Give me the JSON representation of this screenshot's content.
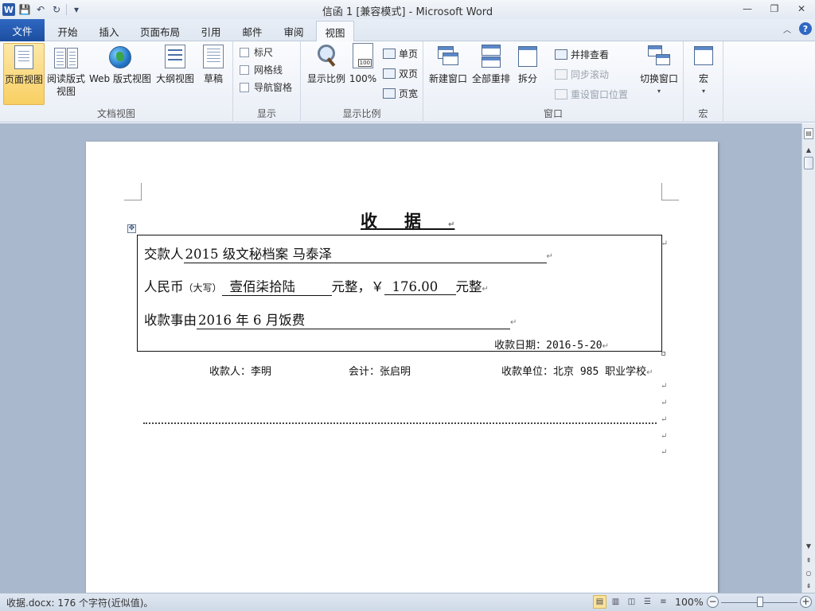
{
  "window": {
    "title": "信函 1 [兼容模式] - Microsoft Word",
    "logo": "W",
    "min_icon": "—",
    "restore_icon": "❐",
    "close_icon": "✕"
  },
  "quick_access": {
    "save": "💾",
    "undo": "↶",
    "redo": "↻",
    "more": "▾"
  },
  "tabs": [
    {
      "label": "文件"
    },
    {
      "label": "开始"
    },
    {
      "label": "插入"
    },
    {
      "label": "页面布局"
    },
    {
      "label": "引用"
    },
    {
      "label": "邮件"
    },
    {
      "label": "审阅"
    },
    {
      "label": "视图"
    }
  ],
  "ribbon": {
    "doc_views": {
      "label": "文档视图",
      "buttons": [
        "页面视图",
        "阅读版式视图",
        "Web 版式视图",
        "大纲视图",
        "草稿"
      ]
    },
    "show": {
      "label": "显示",
      "items": [
        "标尺",
        "网格线",
        "导航窗格"
      ]
    },
    "zoom": {
      "label": "显示比例",
      "zoom_btn": "显示比例",
      "hundred": "100%",
      "one_page": "单页",
      "two_pages": "双页",
      "page_width": "页宽"
    },
    "window": {
      "label": "窗口",
      "new_window": "新建窗口",
      "arrange_all": "全部重排",
      "split": "拆分",
      "side_by_side": "并排查看",
      "sync_scroll": "同步滚动",
      "reset_pos": "重设窗口位置",
      "switch": "切换窗口"
    },
    "macros": {
      "label": "宏",
      "button": "宏"
    }
  },
  "document": {
    "title": "收据",
    "line1_label": "交款人",
    "line1_value": "2015 级文秘档案   马泰泽",
    "line2_label": "人民币",
    "line2_note": "（大写）",
    "line2_value": "壹佰柒拾陆",
    "line2_mid": "元整，￥",
    "line2_amount": "176.00",
    "line2_end": "元整",
    "line3_label": "收款事由",
    "line3_value": "2016 年 6 月饭费",
    "date": "收款日期：2016-5-20",
    "payee": "收款人：李明",
    "accountant": "会计：张启明",
    "unit": "收款单位：北京 985 职业学校"
  },
  "status": {
    "text": "收据.docx: 176 个字符(近似值)。",
    "zoom": "100%",
    "zoom_value": 1.0
  },
  "colors": {
    "accent": "#2f68c2",
    "selected": "#f8cf62",
    "workspace": "#a9b8cc"
  }
}
